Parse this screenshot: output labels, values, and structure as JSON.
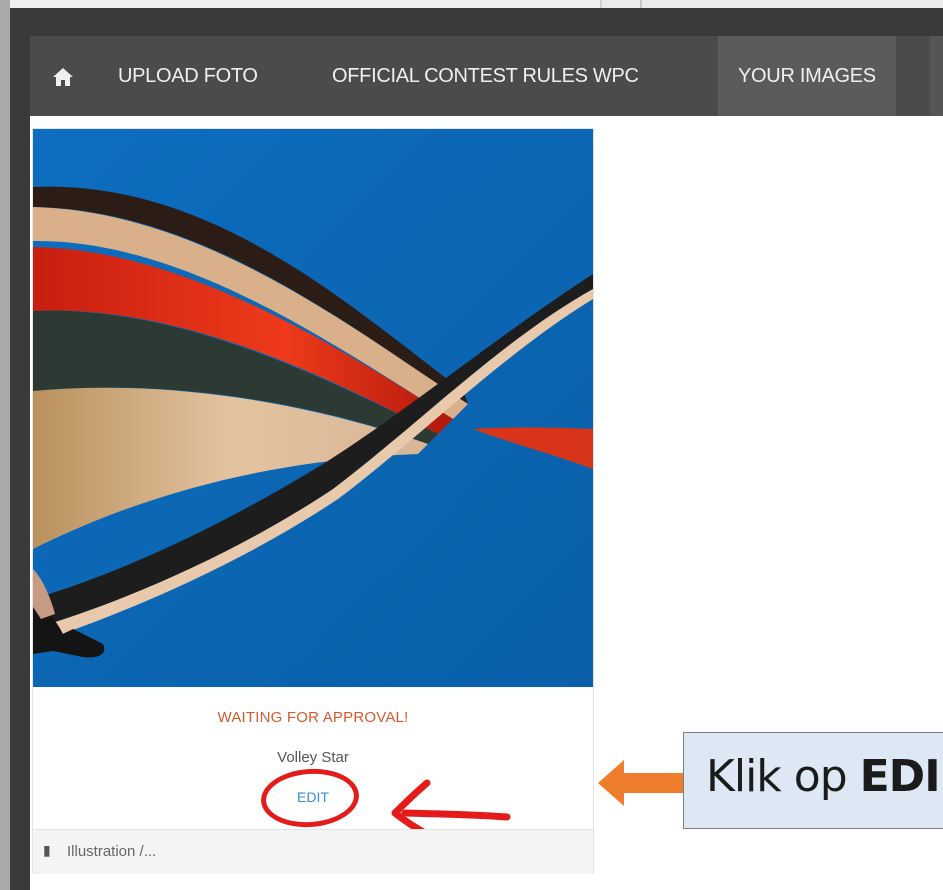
{
  "nav": {
    "home_icon": "home-icon",
    "items": [
      "UPLOAD FOTO",
      "OFFICIAL CONTEST RULES WPC",
      "YOUR IMAGES"
    ],
    "active": "YOUR IMAGES"
  },
  "card": {
    "image_subject": "volleyball-player-motion-blur",
    "status": "WAITING FOR APPROVAL!",
    "title": "Volley Star",
    "edit_label": "EDIT",
    "footer_icon": "book-icon",
    "footer_text": "Illustration /..."
  },
  "annotation": {
    "callout_prefix": "Klik op ",
    "callout_bold": "EDI",
    "circle_color": "#e31b1b",
    "arrow_color": "#ee7d2e"
  },
  "colors": {
    "status": "#d35a2e",
    "edit": "#3a8ed3",
    "navbar": "#4b4b4b",
    "image_bg": "#0a67b6",
    "callout_bg": "#dde8f4"
  }
}
